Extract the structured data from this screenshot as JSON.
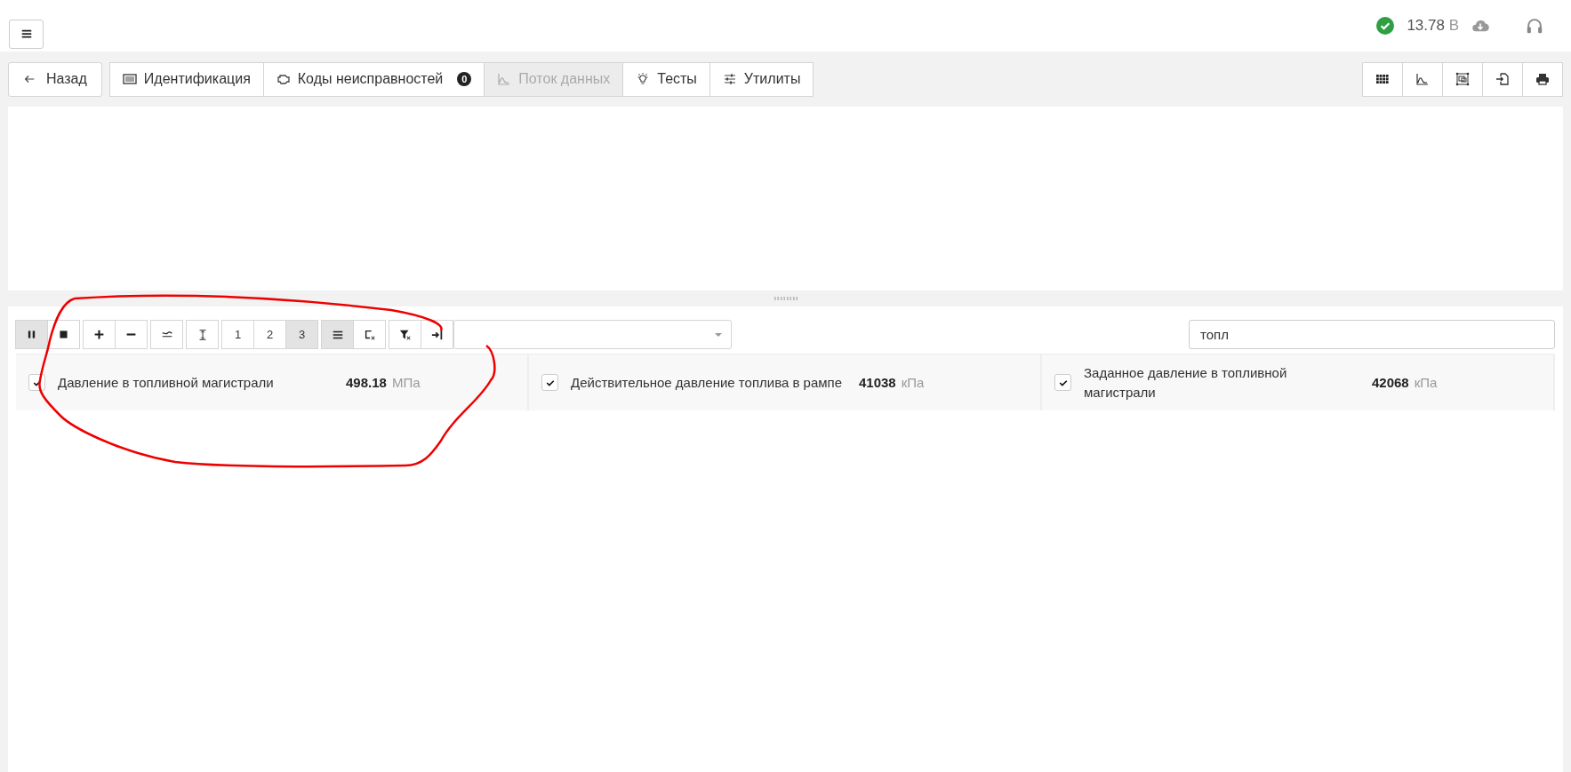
{
  "header": {
    "voltage": "13.78",
    "voltage_unit": "В",
    "connected": true
  },
  "tabs": [
    {
      "kind": "back",
      "label": "Назад",
      "selected": false
    },
    {
      "kind": "id",
      "label": "Идентификация",
      "selected": false
    },
    {
      "kind": "dtc",
      "label": "Коды неисправностей",
      "badge": "0",
      "selected": false
    },
    {
      "kind": "flow",
      "label": "Поток данных",
      "selected": true
    },
    {
      "kind": "tests",
      "label": "Тесты",
      "selected": false
    },
    {
      "kind": "utils",
      "label": "Утилиты",
      "selected": false
    }
  ],
  "view_buttons": [
    {
      "kind": "grid"
    },
    {
      "kind": "chart"
    },
    {
      "kind": "fit"
    },
    {
      "kind": "import"
    },
    {
      "kind": "print"
    }
  ],
  "toolbar": {
    "groups": [
      {
        "buttons": [
          {
            "kind": "pause",
            "selected": true
          },
          {
            "kind": "stop",
            "selected": false
          }
        ]
      },
      {
        "buttons": [
          {
            "kind": "plus",
            "selected": false
          },
          {
            "kind": "minus",
            "selected": false
          }
        ]
      },
      {
        "buttons": [
          {
            "kind": "wave",
            "selected": false
          }
        ]
      },
      {
        "buttons": [
          {
            "kind": "height",
            "selected": false
          }
        ]
      },
      {
        "buttons": [
          {
            "kind": "number",
            "label": "1",
            "selected": false
          },
          {
            "kind": "number",
            "label": "2",
            "selected": false
          },
          {
            "kind": "number",
            "label": "3",
            "selected": true
          }
        ]
      },
      {
        "buttons": [
          {
            "kind": "list",
            "selected": true
          },
          {
            "kind": "clear",
            "selected": false
          }
        ]
      },
      {
        "buttons": [
          {
            "kind": "filter-clear",
            "selected": false
          },
          {
            "kind": "jump",
            "selected": false
          }
        ]
      }
    ],
    "search": {
      "value": "топл"
    }
  },
  "parameters": [
    {
      "checked": true,
      "name": "Давление в топливной магистрали",
      "value": "498.18",
      "unit": "МПа"
    },
    {
      "checked": true,
      "name": "Действительное давление топлива в рампе",
      "value": "41038",
      "unit": "кПа"
    },
    {
      "checked": true,
      "name": "Заданное давление в топливной магистрали",
      "value": "42068",
      "unit": "кПа"
    }
  ]
}
